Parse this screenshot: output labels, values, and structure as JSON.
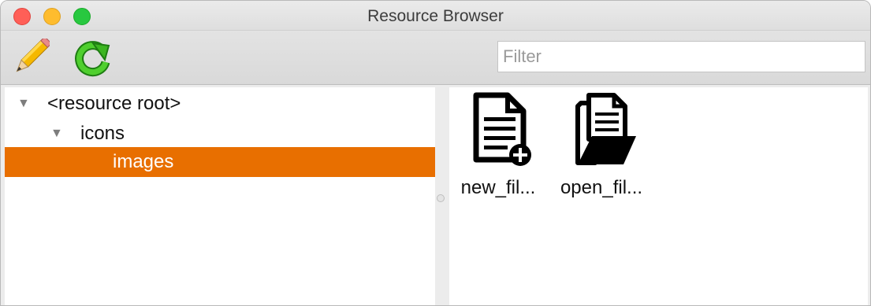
{
  "window": {
    "title": "Resource Browser"
  },
  "toolbar": {
    "edit_icon": "pencil-icon",
    "refresh_icon": "refresh-icon",
    "filter_placeholder": "Filter"
  },
  "tree": {
    "items": [
      {
        "label": "<resource root>",
        "expanded": true,
        "selected": false
      },
      {
        "label": "icons",
        "expanded": true,
        "selected": false
      },
      {
        "label": "images",
        "expanded": false,
        "selected": true
      }
    ],
    "selection_color": "#E86F00"
  },
  "files": [
    {
      "label": "new_fil...",
      "icon": "new-file-icon"
    },
    {
      "label": "open_fil...",
      "icon": "open-file-icon"
    }
  ]
}
